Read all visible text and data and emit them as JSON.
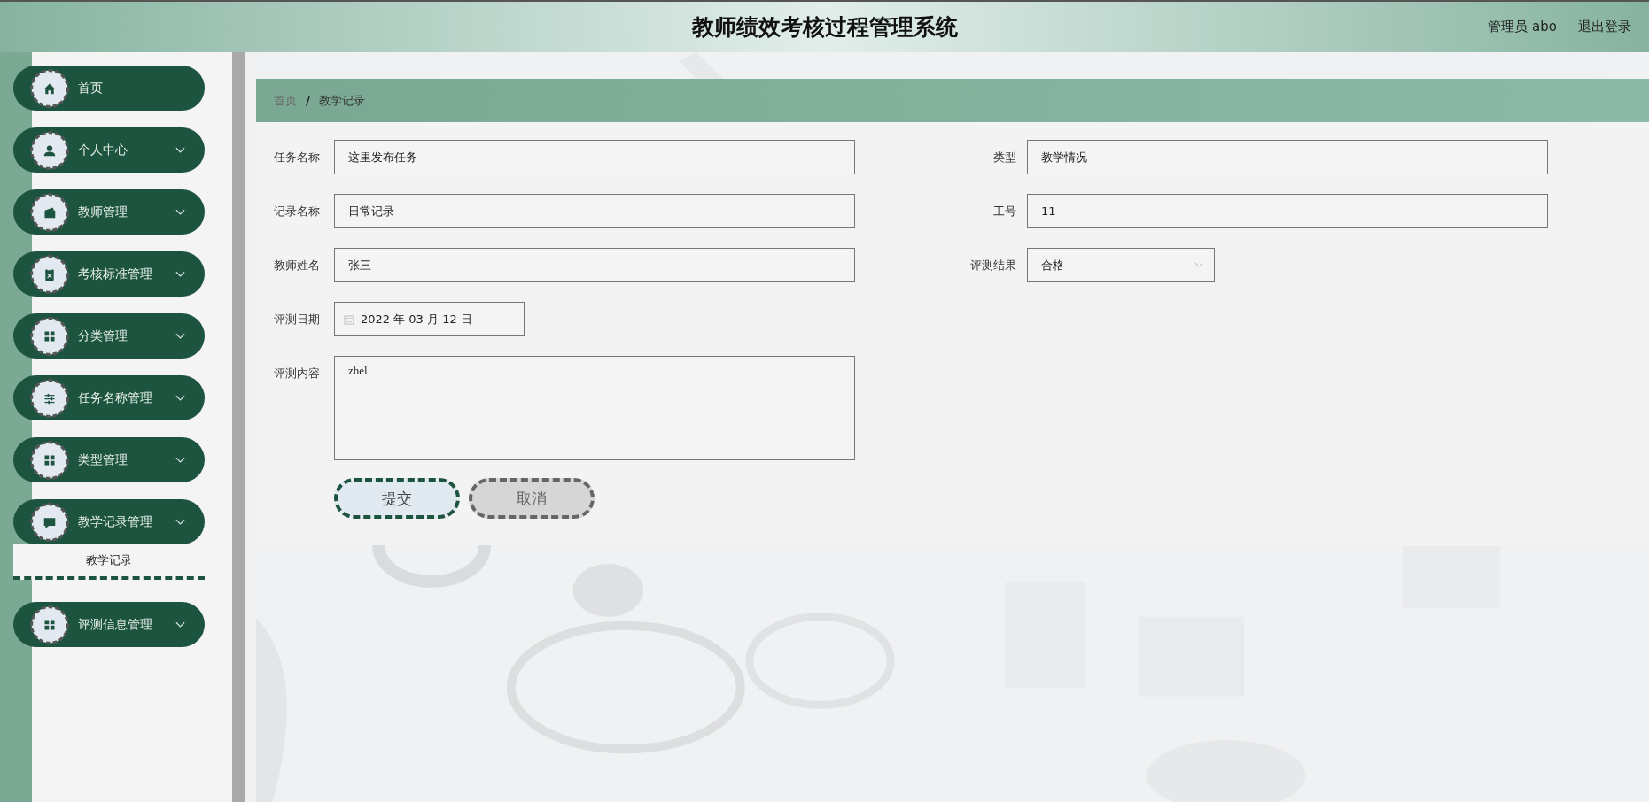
{
  "header": {
    "title": "教师绩效考核过程管理系统",
    "user": "管理员 abo",
    "logout": "退出登录"
  },
  "sidebar": {
    "items": [
      {
        "label": "首页",
        "has_submenu": false,
        "expanded": false
      },
      {
        "label": "个人中心",
        "has_submenu": true,
        "expanded": false
      },
      {
        "label": "教师管理",
        "has_submenu": true,
        "expanded": false
      },
      {
        "label": "考核标准管理",
        "has_submenu": true,
        "expanded": false
      },
      {
        "label": "分类管理",
        "has_submenu": true,
        "expanded": false
      },
      {
        "label": "任务名称管理",
        "has_submenu": true,
        "expanded": false
      },
      {
        "label": "类型管理",
        "has_submenu": true,
        "expanded": false
      },
      {
        "label": "教学记录管理",
        "has_submenu": true,
        "expanded": true,
        "children": [
          {
            "label": "教学记录",
            "selected": true
          }
        ]
      },
      {
        "label": "评测信息管理",
        "has_submenu": true,
        "expanded": false
      }
    ]
  },
  "breadcrumb": {
    "items": [
      "首页",
      "教学记录"
    ],
    "separator": "/"
  },
  "form": {
    "rows": [
      [
        {
          "label": "任务名称",
          "value": "这里发布任务",
          "kind": "text"
        },
        {
          "label": "类型",
          "value": "教学情况",
          "kind": "text"
        }
      ],
      [
        {
          "label": "记录名称",
          "value": "日常记录",
          "kind": "text"
        },
        {
          "label": "工号",
          "value": "11",
          "kind": "text"
        }
      ],
      [
        {
          "label": "教师姓名",
          "value": "张三",
          "kind": "text"
        },
        {
          "label": "评测结果",
          "value": "合格",
          "kind": "select"
        }
      ],
      [
        {
          "label": "评测日期",
          "value": "2022 年 03 月 12 日",
          "kind": "date"
        }
      ],
      [
        {
          "label": "评测内容",
          "value": "zhel",
          "kind": "textarea"
        }
      ]
    ],
    "buttons": [
      {
        "label": "提交",
        "kind": "primary"
      },
      {
        "label": "取消",
        "kind": "secondary"
      }
    ]
  }
}
